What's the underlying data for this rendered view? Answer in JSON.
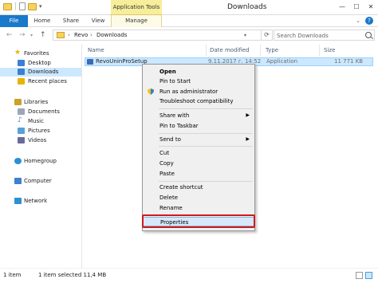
{
  "window": {
    "title": "Downloads",
    "contextual_tab_group": "Application Tools",
    "buttons": {
      "minimize": "—",
      "maximize": "☐",
      "close": "✕"
    }
  },
  "ribbon": {
    "tabs": [
      "File",
      "Home",
      "Share",
      "View",
      "Manage"
    ],
    "help": "?"
  },
  "address": {
    "crumbs": [
      "Revo",
      "Downloads"
    ],
    "separator": "›",
    "search_placeholder": "Search Downloads"
  },
  "nav": {
    "items": [
      {
        "label": "Favorites",
        "icon": "star-icon",
        "color": "#e8b400"
      },
      {
        "label": "Desktop",
        "icon": "desktop-icon",
        "color": "#3d7fd1"
      },
      {
        "label": "Downloads",
        "icon": "downloads-icon",
        "color": "#3d7fd1",
        "selected": true
      },
      {
        "label": "Recent places",
        "icon": "recent-places-icon",
        "color": "#e8b400"
      },
      {
        "label": "Libraries",
        "icon": "libraries-icon",
        "color": "#c9a227"
      },
      {
        "label": "Documents",
        "icon": "documents-icon",
        "color": "#9aa7b8"
      },
      {
        "label": "Music",
        "icon": "music-icon",
        "color": "#3d7fd1"
      },
      {
        "label": "Pictures",
        "icon": "pictures-icon",
        "color": "#5aa0d8"
      },
      {
        "label": "Videos",
        "icon": "videos-icon",
        "color": "#6a6a9a"
      },
      {
        "label": "Homegroup",
        "icon": "homegroup-icon",
        "color": "#2d8fd5"
      },
      {
        "label": "Computer",
        "icon": "computer-icon",
        "color": "#3d7fd1"
      },
      {
        "label": "Network",
        "icon": "network-icon",
        "color": "#2d8fd5"
      }
    ]
  },
  "columns": [
    "Name",
    "Date modified",
    "Type",
    "Size"
  ],
  "file": {
    "name": "RevoUninProSetup",
    "date": "9.11.2017 г. 14:52",
    "type": "Application",
    "size": "11 771 KB"
  },
  "context_menu": {
    "items": [
      "Open",
      "Pin to Start",
      "Run as administrator",
      "Troubleshoot compatibility",
      "Share with",
      "Pin to Taskbar",
      "Send to",
      "Cut",
      "Copy",
      "Paste",
      "Create shortcut",
      "Delete",
      "Rename",
      "Properties"
    ],
    "submenu_arrow": "▶"
  },
  "status": {
    "item_count": "1 item",
    "selection": "1 item selected  11,4 MB"
  }
}
